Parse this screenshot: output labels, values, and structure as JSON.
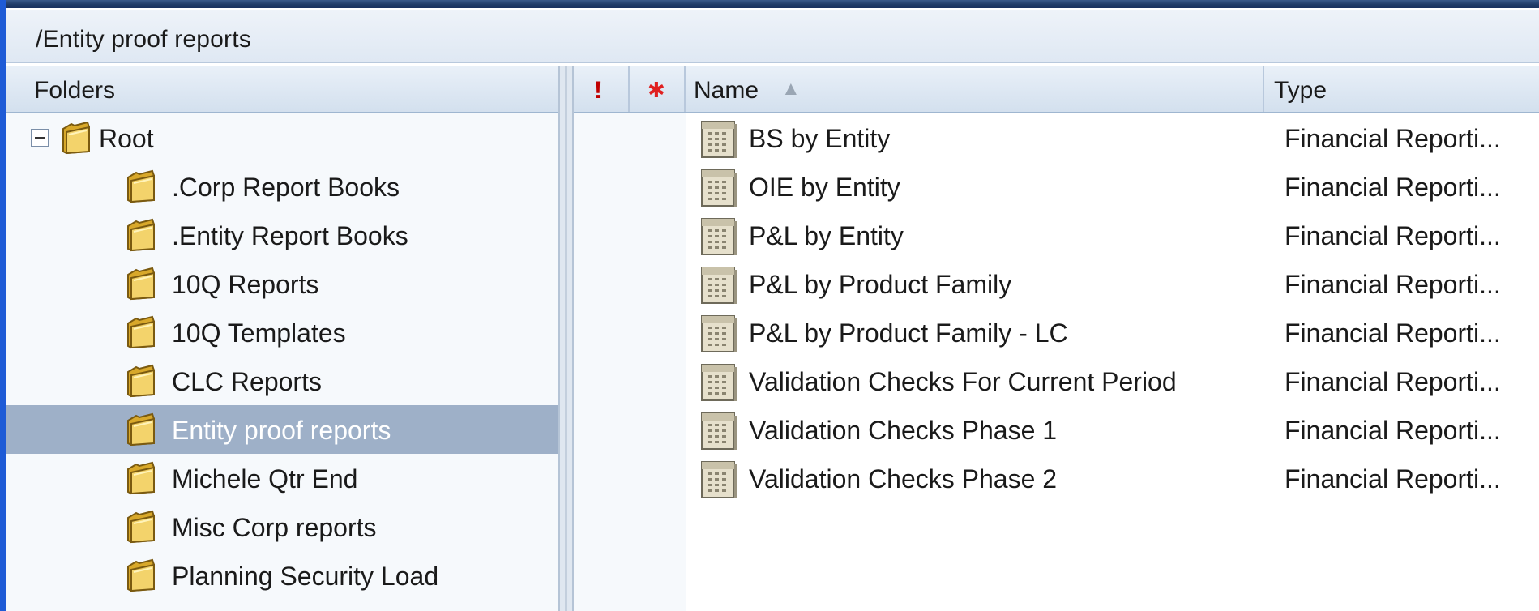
{
  "path": "/Entity proof reports",
  "folders_panel": {
    "header": "Folders",
    "root": {
      "label": "Root",
      "expanded": true
    },
    "items": [
      {
        "label": ".Corp Report Books",
        "selected": false
      },
      {
        "label": ".Entity Report Books",
        "selected": false
      },
      {
        "label": "10Q Reports",
        "selected": false
      },
      {
        "label": "10Q Templates",
        "selected": false
      },
      {
        "label": "CLC Reports",
        "selected": false
      },
      {
        "label": "Entity proof reports",
        "selected": true
      },
      {
        "label": "Michele Qtr End",
        "selected": false
      },
      {
        "label": "Misc Corp reports",
        "selected": false
      },
      {
        "label": "Planning Security Load",
        "selected": false
      }
    ]
  },
  "file_list": {
    "columns": {
      "priority": "!",
      "new": "✱",
      "name": "Name",
      "name_sort": "▲",
      "type": "Type"
    },
    "rows": [
      {
        "name": "BS by Entity",
        "type": "Financial Reporti..."
      },
      {
        "name": "OIE by Entity",
        "type": "Financial Reporti..."
      },
      {
        "name": "P&L by Entity",
        "type": "Financial Reporti..."
      },
      {
        "name": "P&L by Product Family",
        "type": "Financial Reporti..."
      },
      {
        "name": "P&L by Product Family - LC",
        "type": "Financial Reporti..."
      },
      {
        "name": "Validation Checks For Current Period",
        "type": "Financial Reporti..."
      },
      {
        "name": "Validation Checks Phase 1",
        "type": "Financial Reporti..."
      },
      {
        "name": "Validation Checks Phase 2",
        "type": "Financial Reporti..."
      }
    ]
  },
  "icons": {
    "folder": "folder-icon",
    "report": "report-document-icon",
    "collapse": "collapse-icon"
  },
  "colors": {
    "selection": "#9eb0c8",
    "priority_mark": "#c00000",
    "new_mark": "#e02020",
    "accent_edge": "#1e5bd6"
  }
}
